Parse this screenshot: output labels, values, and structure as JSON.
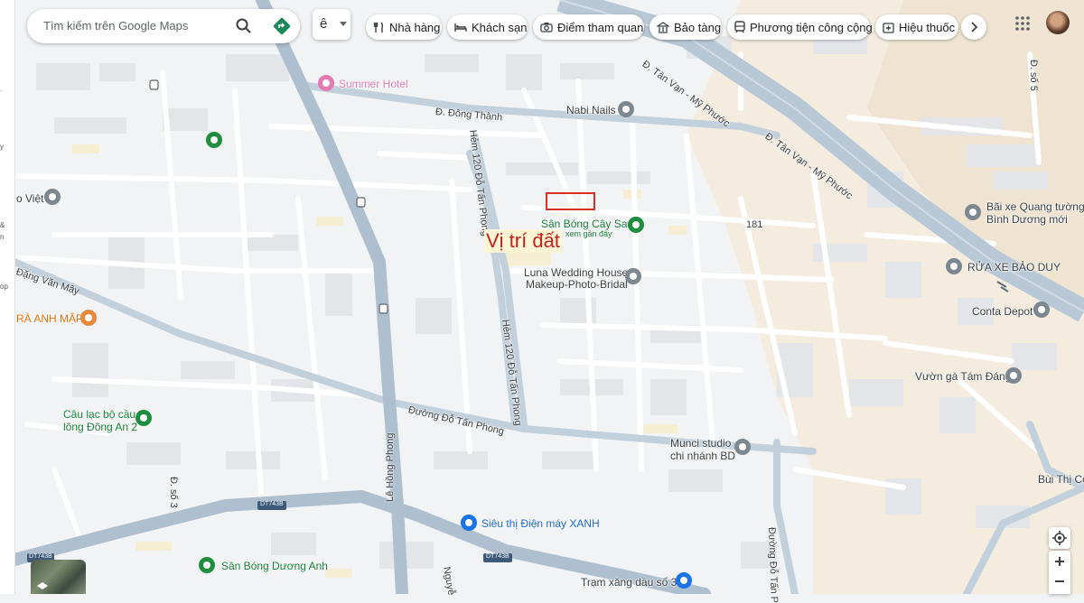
{
  "search": {
    "placeholder": "Tìm kiếm trên Google Maps"
  },
  "layer_selector": {
    "selected": "ê"
  },
  "chips": [
    {
      "label": "Nhà hàng",
      "icon": "fork-knife-icon"
    },
    {
      "label": "Khách sạn",
      "icon": "bed-icon"
    },
    {
      "label": "Điểm tham quan",
      "icon": "camera-icon"
    },
    {
      "label": "Bảo tàng",
      "icon": "museum-icon"
    },
    {
      "label": "Phương tiện công cộng",
      "icon": "transit-icon"
    },
    {
      "label": "Hiệu thuốc",
      "icon": "pharmacy-icon"
    }
  ],
  "map": {
    "annotation": {
      "callout": "Vị trí đất",
      "box_color": "#d93025"
    },
    "roads": {
      "tan_van_1": "Đ. Tân Vạn - Mỹ Phước",
      "tan_van_2": "Đ. Tân Vạn - Mỹ Phước",
      "dong_thanh": "Đ. Đông Thành",
      "hem_120_top": "Hẻm 120 Đỗ Tấn Phong",
      "hem_120_mid": "Hẻm 120 Đỗ Tấn Phong",
      "do_tan_phong": "Đường Đỗ Tấn Phong",
      "le_hong_phong": "Lê Hồng Phong",
      "d_so_3": "Đ. số 3",
      "d_so_5": "Đ. số 5",
      "dt743b_1": "DT743B",
      "dt743b_2": "DT743B",
      "dt743b_3": "DT743B",
      "nguyen": "Nguyễ",
      "duong_do_tan_p": "Đường Đỗ Tấn P",
      "dang_van_may": "Đặng Văn Mây",
      "num_181": "181"
    },
    "places": [
      {
        "name": "Summer Hotel",
        "color": "#e37ab2"
      },
      {
        "name": "Nabi Nails",
        "color": "#3c4043"
      },
      {
        "name": "Sân Bóng Cây Sao",
        "color": "#188038",
        "sub": "xem gần đây"
      },
      {
        "name": "Luna Wedding House",
        "name2": "Makeup-Photo-Bridal",
        "color": "#3c4043"
      },
      {
        "name": "Bãi xe Quang tường",
        "name2": "Bình Dương mới",
        "color": "#3c4043"
      },
      {
        "name": "RỬA XE BẢO DUY",
        "color": "#3c4043"
      },
      {
        "name": "Conta Depot",
        "color": "#3c4043"
      },
      {
        "name": "Vườn gà Tám Đáng",
        "color": "#3c4043"
      },
      {
        "name": "Munci studio",
        "name2": "chi nhánh BD",
        "color": "#3c4043"
      },
      {
        "name": "Câu lạc bộ cầu",
        "name2": "lông Đông An 2",
        "color": "#188038"
      },
      {
        "name": "Siêu thị Điện máy XANH",
        "color": "#1967d2"
      },
      {
        "name": "Sân Bóng Dương Anh",
        "color": "#188038"
      },
      {
        "name": "Trạm xăng dầu số 3",
        "color": "#3c4043"
      },
      {
        "name": "RÀ ANH MẬP",
        "color": "#e8710a"
      },
      {
        "name": "o Việt",
        "color": "#3c4043"
      },
      {
        "name": "Bùi Thị Côi",
        "color": "#3c4043"
      }
    ]
  }
}
